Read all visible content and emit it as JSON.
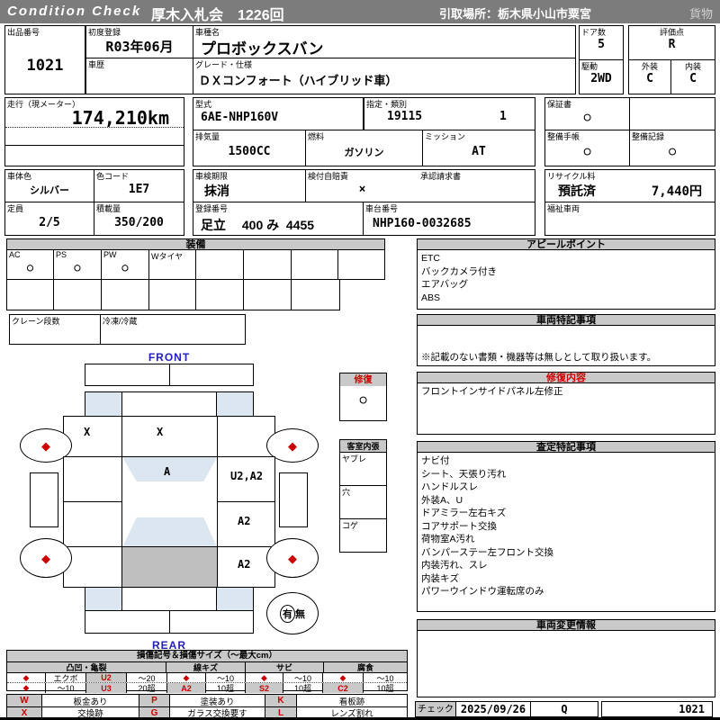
{
  "colors": {
    "accent_red": "#cc0000",
    "header_gray": "#7c7c7c",
    "section_gray": "#c9c9c9",
    "diagram_blue": "#dce6f1",
    "cargo_gray": "#bfbfbf",
    "label_blue": "#2222bb"
  },
  "header": {
    "brand": "Condition  Check",
    "auction": "厚木入札会　1226回",
    "pickup": "引取場所：栃木県小山市粟宮",
    "cargo_type": "貨物"
  },
  "top": {
    "lot_label": "出品番号",
    "lot_no": "1021",
    "first_reg_label": "初度登録",
    "first_reg": "R03年06月",
    "history_label": "車歴",
    "history": "",
    "model_name_label": "車種名",
    "model_name": "プロボックスバン",
    "grade_label": "グレード・仕様",
    "grade": "ＤＸコンフォート（ハイブリッド車）",
    "doors_label": "ドア数",
    "doors": "5",
    "drive_label": "駆動",
    "drive": "2WD",
    "score_label": "評価点",
    "score": "R",
    "exterior_label": "外装",
    "exterior": "C",
    "interior_label": "内装",
    "interior": "C"
  },
  "specs": {
    "mileage_label": "走行（現メーター）",
    "mileage": "174,210km",
    "model_code_label": "型式",
    "model_code": "6AE-NHP160V",
    "class_label": "指定・類別",
    "class_no": "19115",
    "class_sub": "1",
    "displacement_label": "排気量",
    "displacement": "1500CC",
    "fuel_label": "燃料",
    "fuel": "ガソリン",
    "mission_label": "ミッション",
    "mission": "AT",
    "warranty_label": "保証書",
    "warranty": "○",
    "maintenance_book_label": "整備手帳",
    "maintenance_book": "○",
    "maintenance_record_label": "整備記録",
    "maintenance_record": "○"
  },
  "registration": {
    "body_color_label": "車体色",
    "body_color": "シルバー",
    "color_code_label": "色コード",
    "color_code": "1E7",
    "capacity_label": "定員",
    "capacity": "2/5",
    "load_label": "積載量",
    "load": "350/200",
    "inspection_label": "車検期限",
    "inspection": "抹消",
    "insurance_label": "検付自賠責",
    "insurance": "×",
    "approval_label": "承認請求書",
    "approval": "",
    "reg_no_label": "登録番号",
    "reg_no": "足立　 400 み  4455",
    "chassis_label": "車台番号",
    "chassis": "NHP160-0032685",
    "recycle_label": "リサイクル料",
    "recycle_status": "預託済",
    "recycle_fee": "7,440円",
    "welfare_label": "福祉車両",
    "welfare": ""
  },
  "equipment": {
    "title": "装備",
    "cells": [
      {
        "label": "AC",
        "value": "○"
      },
      {
        "label": "PS",
        "value": "○"
      },
      {
        "label": "PW",
        "value": "○"
      },
      {
        "label": "Wタイヤ",
        "value": ""
      },
      {
        "label": "",
        "value": ""
      },
      {
        "label": "",
        "value": ""
      },
      {
        "label": "",
        "value": ""
      },
      {
        "label": "",
        "value": ""
      }
    ],
    "crane_label": "クレーン段数",
    "crane": "",
    "fridge_label": "冷凍/冷蔵",
    "fridge": ""
  },
  "appeal": {
    "title": "アピールポイント",
    "items": [
      "ETC",
      "バックカメラ付き",
      "エアバッグ",
      "ABS"
    ]
  },
  "vehicle_notes": {
    "title": "車両特記事項",
    "note": "※記載のない書類・機器等は無しとして取り扱います。"
  },
  "repair_contents": {
    "title": "修復内容",
    "items": [
      "フロントインサイドパネル左修正"
    ]
  },
  "assessment": {
    "title": "査定特記事項",
    "items": [
      "ナビ付",
      "シート、天張り汚れ",
      "ハンドルスレ",
      "外装A、U",
      "ドアミラー左右キズ",
      "コアサポート交換",
      "荷物室A汚れ",
      "バンパーステー左フロント交換",
      "内装汚れ、スレ",
      "内装キズ",
      "パワーウインドウ運転席のみ"
    ]
  },
  "change_info": {
    "title": "車両変更情報"
  },
  "diagram": {
    "front_label": "FRONT",
    "rear_label": "REAR",
    "marks": {
      "fender_left": "X",
      "hood": "X",
      "windshield": "A",
      "door_right_front": "U2,A2",
      "door_right_rear": "A2",
      "quarter_right": "A2"
    },
    "wheel_mark": "◆",
    "repair_box": {
      "title": "修復",
      "value": "○"
    },
    "cabin_lining": {
      "title": "客室内張",
      "rows": [
        "ヤブレ",
        "穴",
        "コゲ"
      ]
    },
    "spare": {
      "yes": "有",
      "no": "無"
    }
  },
  "legend": {
    "title": "損傷記号＆損傷サイズ（～最大cm）",
    "groups": [
      {
        "name": "凸凹・亀裂",
        "rows": [
          [
            "◆",
            "エクボ",
            "U2",
            "～20"
          ],
          [
            "◆",
            "～10",
            "U3",
            "20超"
          ]
        ]
      },
      {
        "name": "線キズ",
        "rows": [
          [
            "◆",
            "～10"
          ],
          [
            "A2",
            "10超"
          ]
        ]
      },
      {
        "name": "サビ",
        "rows": [
          [
            "◆",
            "～10"
          ],
          [
            "S2",
            "10超"
          ]
        ]
      },
      {
        "name": "腐食",
        "rows": [
          [
            "◆",
            "～10"
          ],
          [
            "C2",
            "10超"
          ]
        ]
      }
    ],
    "codes": [
      {
        "code": "W",
        "desc": "板金あり"
      },
      {
        "code": "P",
        "desc": "塗装あり"
      },
      {
        "code": "K",
        "desc": "看板跡"
      },
      {
        "code": "X",
        "desc": "交換跡"
      },
      {
        "code": "G",
        "desc": "ガラス交換要す"
      },
      {
        "code": "L",
        "desc": "レンズ割れ"
      }
    ]
  },
  "footer": {
    "check_label": "チェック",
    "date": "2025/09/26",
    "inspector": "Q",
    "lot_no": "1021"
  }
}
